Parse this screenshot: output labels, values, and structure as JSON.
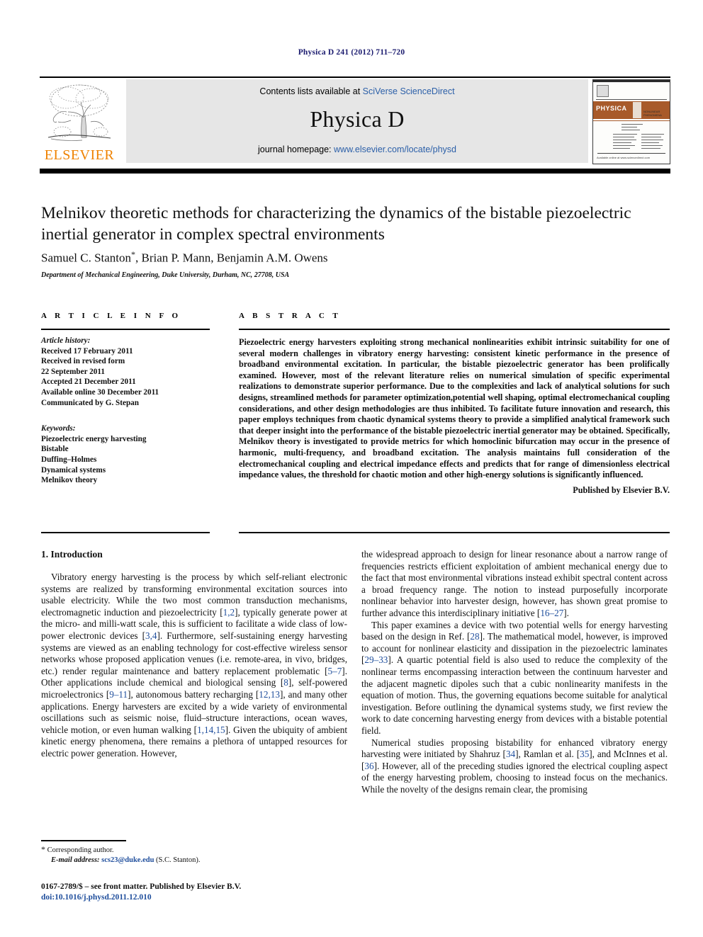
{
  "running_head": "Physica D 241 (2012) 711–720",
  "header": {
    "contents_prefix": "Contents lists available at ",
    "sciencedirect": "SciVerse ScienceDirect",
    "journal_name": "Physica D",
    "homepage_prefix": "journal homepage: ",
    "homepage_url": "www.elsevier.com/locate/physd",
    "publisher_logo_text": "ELSEVIER",
    "cover": {
      "band_title": "PHYSICA",
      "band_letter": "D",
      "band_subtitle": "NONLINEAR PHENOMENA",
      "footer_text": "Available online at www.sciencedirect.com"
    },
    "accent_orange": "#ef8200",
    "link_blue": "#2b5fa8",
    "banner_gray": "#e6e6e6",
    "cover_band_brown": "#a85a2a"
  },
  "article": {
    "title": "Melnikov theoretic methods for characterizing the dynamics of the bistable piezoelectric inertial generator in complex spectral environments",
    "authors": "Samuel C. Stanton*, Brian P. Mann, Benjamin A.M. Owens",
    "affiliation": "Department of Mechanical Engineering, Duke University, Durham, NC, 27708, USA"
  },
  "article_info": {
    "heading": "A R T I C L E   I N F O",
    "history_label": "Article history:",
    "history": [
      "Received 17 February 2011",
      "Received in revised form",
      "22 September 2011",
      "Accepted 21 December 2011",
      "Available online 30 December 2011",
      "Communicated by G. Stepan"
    ],
    "keywords_label": "Keywords:",
    "keywords": [
      "Piezoelectric energy harvesting",
      "Bistable",
      "Duffing–Holmes",
      "Dynamical systems",
      "Melnikov theory"
    ]
  },
  "abstract": {
    "heading": "A B S T R A C T",
    "text": "Piezoelectric energy harvesters exploiting strong mechanical nonlinearities exhibit intrinsic suitability for one of several modern challenges in vibratory energy harvesting: consistent kinetic performance in the presence of broadband environmental excitation. In particular, the bistable piezoelectric generator has been prolifically examined. However, most of the relevant literature relies on numerical simulation of specific experimental realizations to demonstrate superior performance. Due to the complexities and lack of analytical solutions for such designs, streamlined methods for parameter optimization,potential well shaping, optimal electromechanical coupling considerations, and other design methodologies are thus inhibited. To facilitate future innovation and research, this paper employs techniques from chaotic dynamical systems theory to provide a simplified analytical framework such that deeper insight into the performance of the bistable piezoelectric inertial generator may be obtained. Specifically, Melnikov theory is investigated to provide metrics for which homoclinic bifurcation may occur in the presence of harmonic, multi-frequency, and broadband excitation. The analysis maintains full consideration of the electromechanical coupling and electrical impedance effects and predicts that for range of dimensionless electrical impedance values, the threshold for chaotic motion and other high-energy solutions is significantly influenced.",
    "publisher_line": "Published by Elsevier B.V."
  },
  "body": {
    "section_heading": "1. Introduction",
    "left_paragraphs": [
      {
        "parts": [
          {
            "t": "Vibratory energy harvesting is the process by which self-reliant electronic systems are realized by transforming environmental excitation sources into usable electricity. While the two most common transduction mechanisms, electromagnetic induction and piezoelectricity ["
          },
          {
            "t": "1,2",
            "ref": true
          },
          {
            "t": "], typically generate power at the micro- and milli-watt scale, this is sufficient to facilitate a wide class of low-power electronic devices ["
          },
          {
            "t": "3,4",
            "ref": true
          },
          {
            "t": "]. Furthermore, self-sustaining energy harvesting systems are viewed as an enabling technology for cost-effective wireless sensor networks whose proposed application venues (i.e. remote-area, in vivo, bridges, etc.) render regular maintenance and battery replacement problematic ["
          },
          {
            "t": "5–7",
            "ref": true
          },
          {
            "t": "]. Other applications include chemical and biological sensing ["
          },
          {
            "t": "8",
            "ref": true
          },
          {
            "t": "], self-powered microelectronics ["
          },
          {
            "t": "9–11",
            "ref": true
          },
          {
            "t": "], autonomous battery recharging ["
          },
          {
            "t": "12,13",
            "ref": true
          },
          {
            "t": "], and many other applications. Energy harvesters are excited by a wide variety of environmental oscillations such as seismic noise, fluid–structure interactions, ocean waves, vehicle motion, or even human walking ["
          },
          {
            "t": "1,14,15",
            "ref": true
          },
          {
            "t": "]. Given the ubiquity of ambient kinetic energy phenomena, there remains a plethora of untapped resources for electric power generation. However,"
          }
        ]
      }
    ],
    "right_paragraphs": [
      {
        "indent": false,
        "parts": [
          {
            "t": "the widespread approach to design for linear resonance about a narrow range of frequencies restricts efficient exploitation of ambient mechanical energy due to the fact that most environmental vibrations instead exhibit spectral content across a broad frequency range. The notion to instead purposefully incorporate nonlinear behavior into harvester design, however, has shown great promise to further advance this interdisciplinary initiative ["
          },
          {
            "t": "16–27",
            "ref": true
          },
          {
            "t": "]."
          }
        ]
      },
      {
        "indent": true,
        "parts": [
          {
            "t": "This paper examines a device with two potential wells for energy harvesting based on the design in Ref. ["
          },
          {
            "t": "28",
            "ref": true
          },
          {
            "t": "]. The mathematical model, however, is improved to account for nonlinear elasticity and dissipation in the piezoelectric laminates ["
          },
          {
            "t": "29–33",
            "ref": true
          },
          {
            "t": "]. A quartic potential field is also used to reduce the complexity of the nonlinear terms encompassing interaction between the continuum harvester and the adjacent magnetic dipoles such that a cubic nonlinearity manifests in the equation of motion. Thus, the governing equations become suitable for analytical investigation. Before outlining the dynamical systems study, we first review the work to date concerning harvesting energy from devices with a bistable potential field."
          }
        ]
      },
      {
        "indent": true,
        "parts": [
          {
            "t": "Numerical studies proposing bistability for enhanced vibratory energy harvesting were initiated by Shahruz ["
          },
          {
            "t": "34",
            "ref": true
          },
          {
            "t": "], Ramlan et al. ["
          },
          {
            "t": "35",
            "ref": true
          },
          {
            "t": "], and McInnes et al. ["
          },
          {
            "t": "36",
            "ref": true
          },
          {
            "t": "]. However, all of the preceding studies ignored the electrical coupling aspect of the energy harvesting problem, choosing to instead focus on the mechanics. While the novelty of the designs remain clear, the promising"
          }
        ]
      }
    ]
  },
  "footnote": {
    "corresponding_author": "Corresponding author.",
    "email_label": "E-mail address: ",
    "email": "scs23@duke.edu",
    "email_suffix": " (S.C. Stanton)."
  },
  "colophon": {
    "issn_line": "0167-2789/$ – see front matter. Published by Elsevier B.V.",
    "doi": "doi:10.1016/j.physd.2011.12.010"
  }
}
